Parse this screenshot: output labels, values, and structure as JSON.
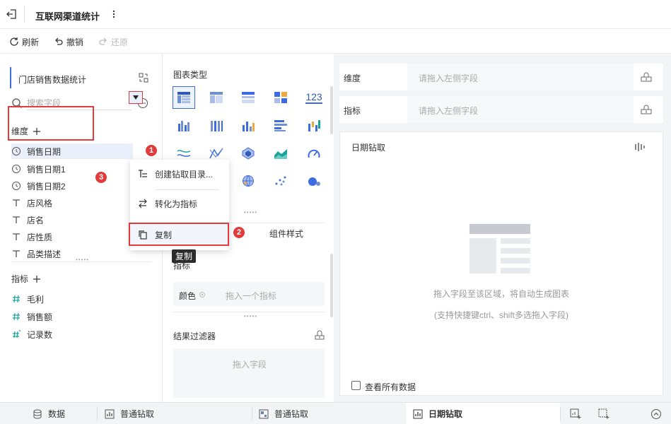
{
  "header": {
    "title": "互联网渠道统计"
  },
  "toolbar": {
    "refresh": "刷新",
    "undo": "撤销",
    "redo": "还原"
  },
  "left": {
    "dataset": "门店销售数据统计",
    "search_placeholder": "搜索字段",
    "dimensions_title": "维度",
    "dimensions": [
      "销售日期",
      "销售日期1",
      "销售日期2",
      "店风格",
      "店名",
      "店性质",
      "品类描述"
    ],
    "metrics_title": "指标",
    "metrics": [
      "毛利",
      "销售额",
      "记录数"
    ]
  },
  "middle": {
    "chart_type_title": "图表类型",
    "chart_icon_text_123": "123",
    "tab_style": "组件样式",
    "metric_section_partial": "指标",
    "color_label": "颜色",
    "color_drop": "拖入一个指标",
    "filter_title": "结果过滤器",
    "filter_drop": "拖入字段"
  },
  "context_menu": {
    "items": [
      "创建钻取目录...",
      "转化为指标",
      "复制"
    ],
    "tooltip": "复制"
  },
  "badges": [
    "1",
    "2",
    "3"
  ],
  "right": {
    "dimension_label": "维度",
    "dimension_drop": "请拖入左侧字段",
    "metric_label": "指标",
    "metric_drop": "请拖入左侧字段",
    "canvas_title": "日期钻取",
    "hint1": "拖入字段至该区域，将自动生成图表",
    "hint2": "(支持快捷键ctrl、shift多选拖入字段)",
    "view_all": "查看所有数据"
  },
  "bottom_tabs": {
    "data": "数据",
    "tab1": "普通钻取",
    "tab2": "普通钻取",
    "tab3": "日期钻取"
  },
  "colors": {
    "accent": "#3c6ce0",
    "highlight_red": "#e23b3b"
  }
}
